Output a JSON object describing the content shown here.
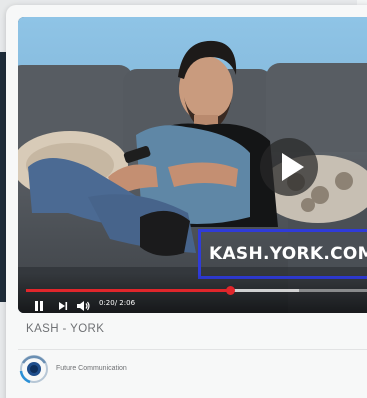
{
  "video": {
    "overlay_text": "KASH.YORK.COM.SA",
    "time_display": "0:20/ 2:06",
    "progress": 0.59,
    "buffered": 0.79,
    "accent_color": "#e0262b"
  },
  "card": {
    "title": "KASH - YORK",
    "channel_name": "Future Communication"
  },
  "icons": {
    "play": "play-icon",
    "pause": "pause-icon",
    "next": "skip-next-icon",
    "volume": "volume-icon",
    "logo": "channel-logo-icon"
  }
}
